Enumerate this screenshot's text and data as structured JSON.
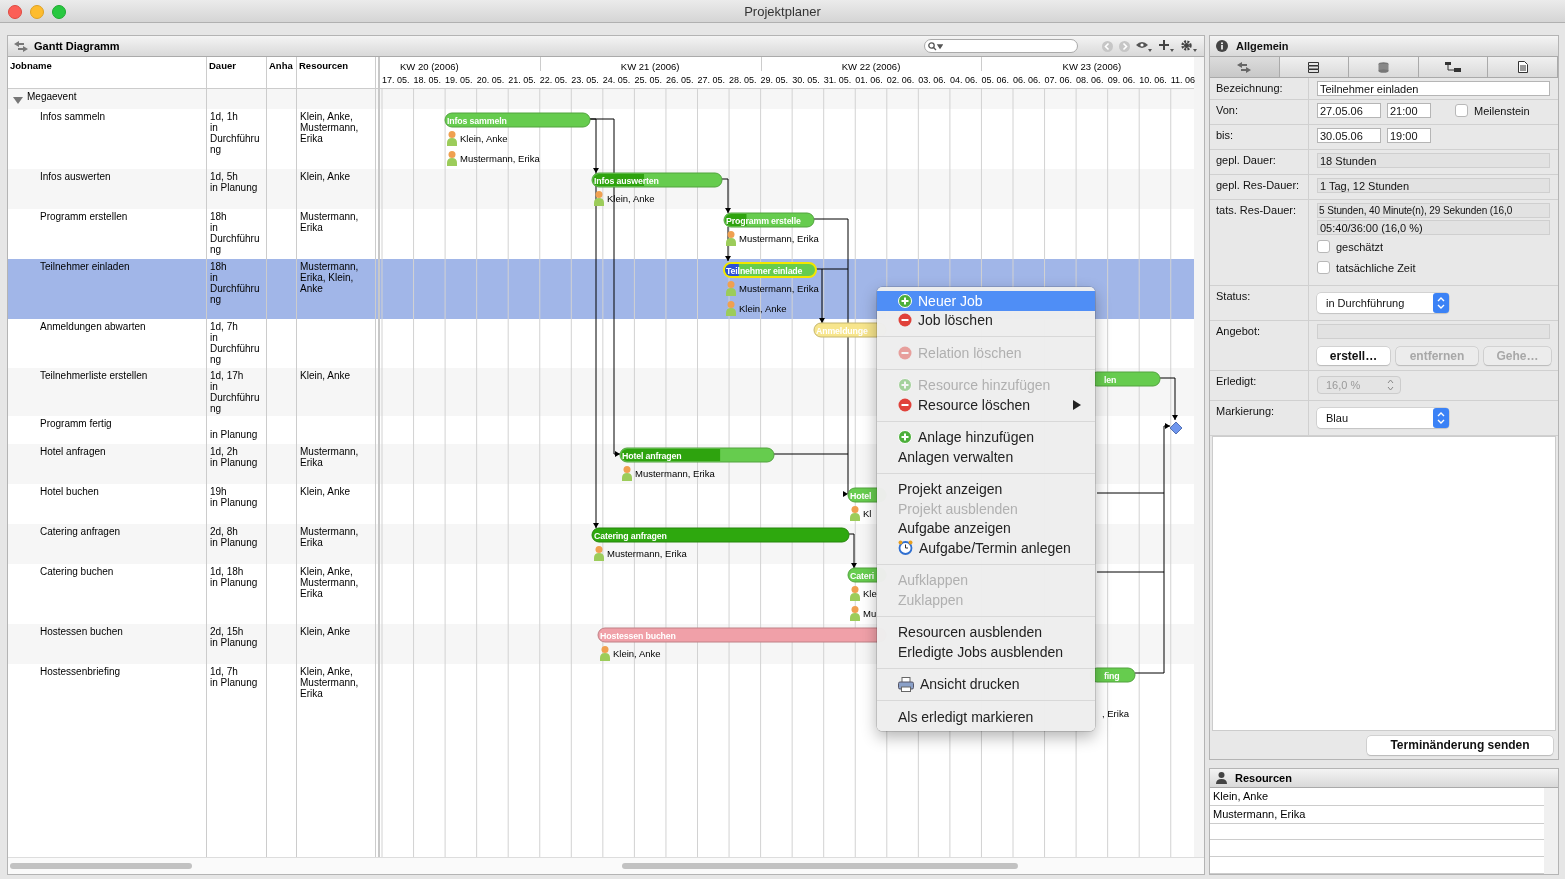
{
  "window": {
    "title": "Projektplaner"
  },
  "gantt_panel": {
    "title": "Gantt Diagramm"
  },
  "table": {
    "columns": [
      "Jobname",
      "Dauer",
      "Anha",
      "Resourcen"
    ],
    "rows": [
      {
        "name": "Megaevent",
        "expanded": true,
        "children": [
          {
            "name": "Infos sammeln",
            "duration": "1d, 1h",
            "status": "in Durchführung",
            "resources": "Klein, Anke, Mustermann, Erika",
            "selected": false
          },
          {
            "name": "Infos auswerten",
            "duration": "1d, 5h",
            "status": "in Planung",
            "resources": "Klein, Anke",
            "selected": false
          },
          {
            "name": "Programm erstellen",
            "duration": "18h",
            "status": "in Durchführung",
            "resources": "Mustermann, Erika",
            "selected": false
          },
          {
            "name": "Teilnehmer einladen",
            "duration": "18h",
            "status": "in Durchführung",
            "resources": "Mustermann, Erika, Klein, Anke",
            "selected": true
          },
          {
            "name": "Anmeldungen abwarten",
            "duration": "1d, 7h",
            "status": "in Durchführung",
            "selected": false
          },
          {
            "name": "Teilnehmerliste erstellen",
            "duration": "1d, 17h",
            "status": "in Durchführung",
            "resources": "Klein, Anke",
            "selected": false
          },
          {
            "name": "Programm fertig",
            "status": "in Planung",
            "selected": false
          },
          {
            "name": "Hotel anfragen",
            "duration": "1d, 2h",
            "status": "in Planung",
            "resources": "Mustermann, Erika",
            "selected": false
          },
          {
            "name": "Hotel buchen",
            "duration": "19h",
            "status": "in Planung",
            "resources": "Klein, Anke",
            "selected": false
          },
          {
            "name": "Catering anfragen",
            "duration": "2d, 8h",
            "status": "in Planung",
            "resources": "Mustermann, Erika",
            "selected": false
          },
          {
            "name": "Catering buchen",
            "duration": "1d, 18h",
            "status": "in Planung",
            "resources": "Klein, Anke, Mustermann, Erika",
            "selected": false
          },
          {
            "name": "Hostessen buchen",
            "duration": "2d, 15h",
            "status": "in Planung",
            "resources": "Klein, Anke",
            "selected": false
          },
          {
            "name": "Hostessenbriefing",
            "duration": "1d, 7h",
            "status": "in Planung",
            "resources": "Klein, Anke, Mustermann, Erika",
            "selected": false
          }
        ]
      }
    ]
  },
  "timeline": {
    "weeks": [
      "KW 20 (2006)",
      "KW 21 (2006)",
      "KW 22 (2006)",
      "KW 23 (2006)"
    ],
    "days": [
      "17. 05.",
      "18. 05.",
      "19. 05.",
      "20. 05.",
      "21. 05.",
      "22. 05.",
      "23. 05.",
      "24. 05.",
      "25. 05.",
      "26. 05.",
      "27. 05.",
      "28. 05.",
      "29. 05.",
      "30. 05.",
      "31. 05.",
      "01. 06.",
      "02. 06.",
      "03. 06.",
      "04. 06.",
      "05. 06.",
      "06. 06.",
      "07. 06.",
      "08. 06.",
      "09. 06.",
      "10. 06.",
      "11. 06"
    ]
  },
  "gantt": {
    "bars": [
      {
        "kind": "bar",
        "label": "Infos sammeln",
        "color": "#66cc4e",
        "resources": [
          "Klein, Anke",
          "Mustermann, Erika"
        ]
      },
      {
        "kind": "bar",
        "label": "Infos auswerten",
        "color": "#66cc4e",
        "level": 0.4,
        "resources": [
          "Klein, Anke"
        ]
      },
      {
        "kind": "bar",
        "label": "Programm erstelle",
        "color": "#66cc4e",
        "level": 0.25,
        "resources": [
          "Mustermann, Erika"
        ]
      },
      {
        "kind": "bar",
        "label": "Teilnehmer einlade",
        "color": "#66cc4e",
        "level": 0.16,
        "resources": [
          "Mustermann, Erika",
          "Klein, Anke"
        ]
      },
      {
        "kind": "bar",
        "label": "Anmeldunge",
        "color": "#f7e58c"
      },
      {
        "kind": "bar",
        "label": "len",
        "color": "#66cc4e"
      },
      {
        "kind": "milestone",
        "color": "#6f96ee"
      },
      {
        "kind": "bar",
        "label": "Hotel anfragen",
        "color": "#66cc4e",
        "level": 0.65,
        "resources": [
          "Mustermann, Erika"
        ]
      },
      {
        "kind": "bar",
        "label": "Hotel",
        "color": "#66cc4e",
        "resources": [
          "Kl"
        ]
      },
      {
        "kind": "bar",
        "label": "Catering anfragen",
        "color": "#2ea80e",
        "resources": [
          "Mustermann, Erika"
        ]
      },
      {
        "kind": "bar",
        "label": "Cateri",
        "color": "#66cc4e",
        "resources": [
          "Kle",
          "Mu"
        ]
      },
      {
        "kind": "bar",
        "label": "Hostessen buchen",
        "color": "#f0a0a8",
        "resources": [
          "Klein, Anke"
        ]
      },
      {
        "kind": "bar",
        "label": "fing",
        "color": "#66cc4e",
        "resources": [
          ", Erika"
        ]
      }
    ]
  },
  "context_menu": {
    "items": [
      {
        "kind": "item",
        "label": "Neuer Job",
        "selected": true,
        "disabled": false,
        "submenu": false
      },
      {
        "kind": "item",
        "label": "Job löschen",
        "selected": false,
        "disabled": false,
        "submenu": false
      },
      {
        "kind": "separator"
      },
      {
        "kind": "item",
        "label": "Relation löschen",
        "selected": false,
        "disabled": true,
        "submenu": false
      },
      {
        "kind": "separator"
      },
      {
        "kind": "item",
        "label": "Resource hinzufügen",
        "selected": false,
        "disabled": true,
        "submenu": false
      },
      {
        "kind": "item",
        "label": "Resource löschen",
        "selected": false,
        "disabled": false,
        "submenu": true
      },
      {
        "kind": "separator"
      },
      {
        "kind": "item",
        "label": "Anlage hinzufügen",
        "selected": false,
        "disabled": false,
        "submenu": false
      },
      {
        "kind": "item",
        "label": "Anlagen verwalten",
        "selected": false,
        "disabled": false,
        "submenu": false
      },
      {
        "kind": "separator"
      },
      {
        "kind": "item",
        "label": "Projekt anzeigen",
        "selected": false,
        "disabled": false,
        "submenu": false
      },
      {
        "kind": "item",
        "label": "Projekt ausblenden",
        "selected": false,
        "disabled": true,
        "submenu": false
      },
      {
        "kind": "item",
        "label": "Aufgabe anzeigen",
        "selected": false,
        "disabled": false,
        "submenu": false
      },
      {
        "kind": "item",
        "label": "Aufgabe/Termin anlegen",
        "selected": false,
        "disabled": false,
        "submenu": false
      },
      {
        "kind": "separator"
      },
      {
        "kind": "item",
        "label": "Aufklappen",
        "selected": false,
        "disabled": true,
        "submenu": false
      },
      {
        "kind": "item",
        "label": "Zuklappen",
        "selected": false,
        "disabled": true,
        "submenu": false
      },
      {
        "kind": "separator"
      },
      {
        "kind": "item",
        "label": "Resourcen ausblenden",
        "selected": false,
        "disabled": false,
        "submenu": false
      },
      {
        "kind": "item",
        "label": "Erledigte Jobs ausblenden",
        "selected": false,
        "disabled": false,
        "submenu": false
      },
      {
        "kind": "separator"
      },
      {
        "kind": "item",
        "label": "Ansicht drucken",
        "selected": false,
        "disabled": false,
        "submenu": false
      },
      {
        "kind": "separator"
      },
      {
        "kind": "item",
        "label": "Als erledigt markieren",
        "selected": false,
        "disabled": false,
        "submenu": false
      }
    ]
  },
  "details": {
    "title": "Allgemein",
    "name": {
      "label": "Bezeichnung:",
      "value": "Teilnehmer einladen"
    },
    "from": {
      "label": "Von:",
      "date": "27.05.06",
      "time": "21:00"
    },
    "milestone": {
      "label": "Meilenstein",
      "checked": false
    },
    "to": {
      "label": "bis:",
      "date": "30.05.06",
      "time": "19:00"
    },
    "planned_duration": {
      "label": "gepl. Dauer:",
      "value": "18 Stunden"
    },
    "planned_res_duration": {
      "label": "gepl. Res-Dauer:",
      "value": "1 Tag, 12 Stunden"
    },
    "actual_res_duration": {
      "label": "tats. Res-Dauer:",
      "value": "5 Stunden, 40 Minute(n), 29 Sekunden (16,0",
      "summary": "05:40/36:00 (16,0 %)",
      "options": [
        {
          "label": "geschätzt",
          "checked": false
        },
        {
          "label": "tatsächliche Zeit",
          "checked": false
        }
      ]
    },
    "status": {
      "label": "Status:",
      "value": "in Durchführung"
    },
    "offer": {
      "label": "Angebot:",
      "buttons": [
        {
          "label": "erstell…",
          "disabled": false
        },
        {
          "label": "entfernen",
          "disabled": true
        },
        {
          "label": "Gehe…",
          "disabled": true
        }
      ]
    },
    "done": {
      "label": "Erledigt:",
      "value": "16,0 %",
      "disabled": true
    },
    "marking": {
      "label": "Markierung:",
      "value": "Blau"
    },
    "send_button": "Terminänderung senden"
  },
  "resources": {
    "title": "Resourcen",
    "items": [
      "Klein, Anke",
      "Mustermann, Erika"
    ]
  }
}
